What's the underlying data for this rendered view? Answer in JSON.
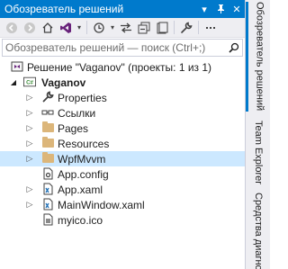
{
  "panel": {
    "title": "Обозреватель решений",
    "pin_icon": "pin-icon",
    "close_icon": "close-icon"
  },
  "toolbar": {
    "icons": [
      "back-icon",
      "forward-icon",
      "home-icon",
      "vs-icon",
      "history-icon",
      "sync-icon",
      "collapse-all-icon",
      "properties-icon"
    ]
  },
  "search": {
    "placeholder": "Обозреватель решений — поиск (Ctrl+;)"
  },
  "tree": {
    "solution": "Решение \"Vaganov\" (проекты: 1 из 1)",
    "project": "Vaganov",
    "project_icon_text": "C#",
    "items": [
      {
        "label": "Properties",
        "icon": "wrench-icon"
      },
      {
        "label": "Ссылки",
        "icon": "references-icon"
      },
      {
        "label": "Pages",
        "icon": "folder-icon"
      },
      {
        "label": "Resources",
        "icon": "folder-icon"
      },
      {
        "label": "WpfMvvm",
        "icon": "folder-icon"
      },
      {
        "label": "App.config",
        "icon": "config-file-icon"
      },
      {
        "label": "App.xaml",
        "icon": "xaml-file-icon"
      },
      {
        "label": "MainWindow.xaml",
        "icon": "xaml-file-icon"
      },
      {
        "label": "myico.ico",
        "icon": "ico-file-icon"
      }
    ]
  },
  "side_tabs": {
    "solution_explorer": "Обозреватель решений",
    "team_explorer": "Team Explorer",
    "diagnostics": "Средства диагност"
  },
  "colors": {
    "accent": "#007acc",
    "selection": "#cce8ff",
    "toolbar_bg": "#eeeef2",
    "folder": "#dcb67a"
  }
}
